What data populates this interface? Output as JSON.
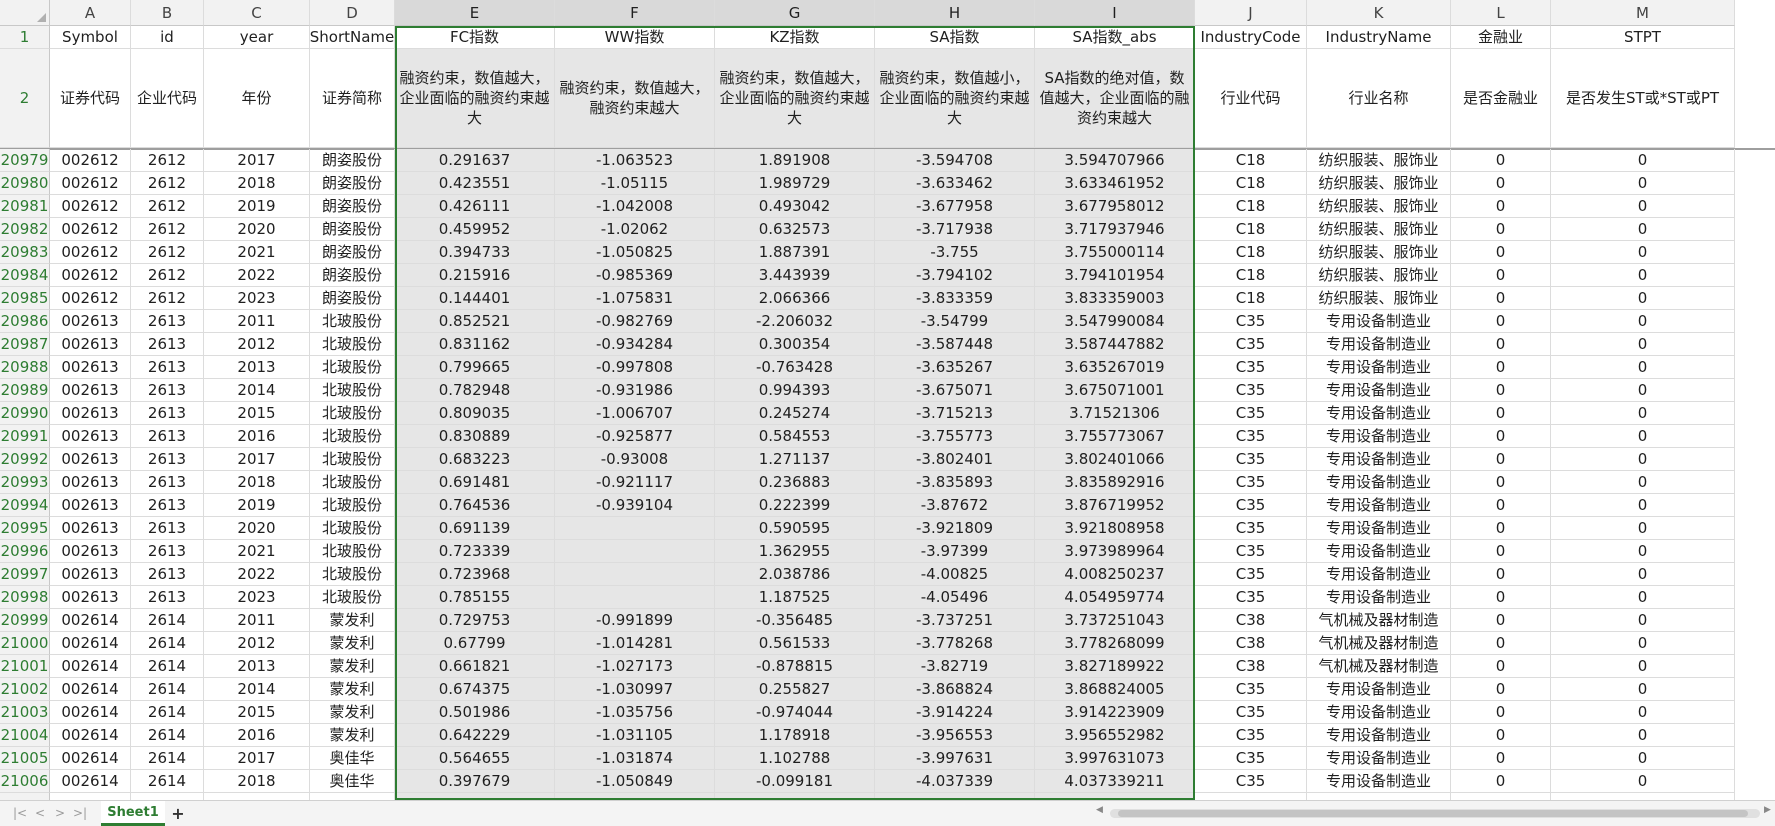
{
  "sheet": {
    "columns": [
      {
        "letter": "A",
        "selected": false
      },
      {
        "letter": "B",
        "selected": false
      },
      {
        "letter": "C",
        "selected": false
      },
      {
        "letter": "D",
        "selected": false
      },
      {
        "letter": "E",
        "selected": true
      },
      {
        "letter": "F",
        "selected": true
      },
      {
        "letter": "G",
        "selected": true
      },
      {
        "letter": "H",
        "selected": true
      },
      {
        "letter": "I",
        "selected": true
      },
      {
        "letter": "J",
        "selected": false
      },
      {
        "letter": "K",
        "selected": false
      },
      {
        "letter": "L",
        "selected": false
      },
      {
        "letter": "M",
        "selected": false
      }
    ],
    "header_row1": {
      "rownum": "1",
      "values": [
        "Symbol",
        "id",
        "year",
        "ShortName",
        "FC指数",
        "WW指数",
        "KZ指数",
        "SA指数",
        "SA指数_abs",
        "IndustryCode",
        "IndustryName",
        "金融业",
        "STPT"
      ]
    },
    "header_row2": {
      "rownum": "2",
      "values": [
        "证券代码",
        "企业代码",
        "年份",
        "证券简称",
        "融资约束，数值越大，企业面临的融资约束越大",
        "融资约束，数值越大，融资约束越大",
        "融资约束，数值越大，企业面临的融资约束越大",
        "融资约束，数值越小，企业面临的融资约束越大",
        "SA指数的绝对值，数值越大，企业面临的融资约束越大",
        "行业代码",
        "行业名称",
        "是否金融业",
        "是否发生ST或*ST或PT"
      ]
    },
    "rows": [
      {
        "rownum": "20979",
        "values": [
          "002612",
          "2612",
          "2017",
          "朗姿股份",
          "0.291637",
          "-1.063523",
          "1.891908",
          "-3.594708",
          "3.594707966",
          "C18",
          "纺织服装、服饰业",
          "0",
          "0"
        ]
      },
      {
        "rownum": "20980",
        "values": [
          "002612",
          "2612",
          "2018",
          "朗姿股份",
          "0.423551",
          "-1.05115",
          "1.989729",
          "-3.633462",
          "3.633461952",
          "C18",
          "纺织服装、服饰业",
          "0",
          "0"
        ]
      },
      {
        "rownum": "20981",
        "values": [
          "002612",
          "2612",
          "2019",
          "朗姿股份",
          "0.426111",
          "-1.042008",
          "0.493042",
          "-3.677958",
          "3.677958012",
          "C18",
          "纺织服装、服饰业",
          "0",
          "0"
        ]
      },
      {
        "rownum": "20982",
        "values": [
          "002612",
          "2612",
          "2020",
          "朗姿股份",
          "0.459952",
          "-1.02062",
          "0.632573",
          "-3.717938",
          "3.717937946",
          "C18",
          "纺织服装、服饰业",
          "0",
          "0"
        ]
      },
      {
        "rownum": "20983",
        "values": [
          "002612",
          "2612",
          "2021",
          "朗姿股份",
          "0.394733",
          "-1.050825",
          "1.887391",
          "-3.755",
          "3.755000114",
          "C18",
          "纺织服装、服饰业",
          "0",
          "0"
        ]
      },
      {
        "rownum": "20984",
        "values": [
          "002612",
          "2612",
          "2022",
          "朗姿股份",
          "0.215916",
          "-0.985369",
          "3.443939",
          "-3.794102",
          "3.794101954",
          "C18",
          "纺织服装、服饰业",
          "0",
          "0"
        ]
      },
      {
        "rownum": "20985",
        "values": [
          "002612",
          "2612",
          "2023",
          "朗姿股份",
          "0.144401",
          "-1.075831",
          "2.066366",
          "-3.833359",
          "3.833359003",
          "C18",
          "纺织服装、服饰业",
          "0",
          "0"
        ]
      },
      {
        "rownum": "20986",
        "values": [
          "002613",
          "2613",
          "2011",
          "北玻股份",
          "0.852521",
          "-0.982769",
          "-2.206032",
          "-3.54799",
          "3.547990084",
          "C35",
          "专用设备制造业",
          "0",
          "0"
        ]
      },
      {
        "rownum": "20987",
        "values": [
          "002613",
          "2613",
          "2012",
          "北玻股份",
          "0.831162",
          "-0.934284",
          "0.300354",
          "-3.587448",
          "3.587447882",
          "C35",
          "专用设备制造业",
          "0",
          "0"
        ]
      },
      {
        "rownum": "20988",
        "values": [
          "002613",
          "2613",
          "2013",
          "北玻股份",
          "0.799665",
          "-0.997808",
          "-0.763428",
          "-3.635267",
          "3.635267019",
          "C35",
          "专用设备制造业",
          "0",
          "0"
        ]
      },
      {
        "rownum": "20989",
        "values": [
          "002613",
          "2613",
          "2014",
          "北玻股份",
          "0.782948",
          "-0.931986",
          "0.994393",
          "-3.675071",
          "3.675071001",
          "C35",
          "专用设备制造业",
          "0",
          "0"
        ]
      },
      {
        "rownum": "20990",
        "values": [
          "002613",
          "2613",
          "2015",
          "北玻股份",
          "0.809035",
          "-1.006707",
          "0.245274",
          "-3.715213",
          "3.71521306",
          "C35",
          "专用设备制造业",
          "0",
          "0"
        ]
      },
      {
        "rownum": "20991",
        "values": [
          "002613",
          "2613",
          "2016",
          "北玻股份",
          "0.830889",
          "-0.925877",
          "0.584553",
          "-3.755773",
          "3.755773067",
          "C35",
          "专用设备制造业",
          "0",
          "0"
        ]
      },
      {
        "rownum": "20992",
        "values": [
          "002613",
          "2613",
          "2017",
          "北玻股份",
          "0.683223",
          "-0.93008",
          "1.271137",
          "-3.802401",
          "3.802401066",
          "C35",
          "专用设备制造业",
          "0",
          "0"
        ]
      },
      {
        "rownum": "20993",
        "values": [
          "002613",
          "2613",
          "2018",
          "北玻股份",
          "0.691481",
          "-0.921117",
          "0.236883",
          "-3.835893",
          "3.835892916",
          "C35",
          "专用设备制造业",
          "0",
          "0"
        ]
      },
      {
        "rownum": "20994",
        "values": [
          "002613",
          "2613",
          "2019",
          "北玻股份",
          "0.764536",
          "-0.939104",
          "0.222399",
          "-3.87672",
          "3.876719952",
          "C35",
          "专用设备制造业",
          "0",
          "0"
        ]
      },
      {
        "rownum": "20995",
        "values": [
          "002613",
          "2613",
          "2020",
          "北玻股份",
          "0.691139",
          "",
          "0.590595",
          "-3.921809",
          "3.921808958",
          "C35",
          "专用设备制造业",
          "0",
          "0"
        ]
      },
      {
        "rownum": "20996",
        "values": [
          "002613",
          "2613",
          "2021",
          "北玻股份",
          "0.723339",
          "",
          "1.362955",
          "-3.97399",
          "3.973989964",
          "C35",
          "专用设备制造业",
          "0",
          "0"
        ]
      },
      {
        "rownum": "20997",
        "values": [
          "002613",
          "2613",
          "2022",
          "北玻股份",
          "0.723968",
          "",
          "2.038786",
          "-4.00825",
          "4.008250237",
          "C35",
          "专用设备制造业",
          "0",
          "0"
        ]
      },
      {
        "rownum": "20998",
        "values": [
          "002613",
          "2613",
          "2023",
          "北玻股份",
          "0.785155",
          "",
          "1.187525",
          "-4.05496",
          "4.054959774",
          "C35",
          "专用设备制造业",
          "0",
          "0"
        ]
      },
      {
        "rownum": "20999",
        "values": [
          "002614",
          "2614",
          "2011",
          "蒙发利",
          "0.729753",
          "-0.991899",
          "-0.356485",
          "-3.737251",
          "3.737251043",
          "C38",
          "气机械及器材制造",
          "0",
          "0"
        ]
      },
      {
        "rownum": "21000",
        "values": [
          "002614",
          "2614",
          "2012",
          "蒙发利",
          "0.67799",
          "-1.014281",
          "0.561533",
          "-3.778268",
          "3.778268099",
          "C38",
          "气机械及器材制造",
          "0",
          "0"
        ]
      },
      {
        "rownum": "21001",
        "values": [
          "002614",
          "2614",
          "2013",
          "蒙发利",
          "0.661821",
          "-1.027173",
          "-0.878815",
          "-3.82719",
          "3.827189922",
          "C38",
          "气机械及器材制造",
          "0",
          "0"
        ]
      },
      {
        "rownum": "21002",
        "values": [
          "002614",
          "2614",
          "2014",
          "蒙发利",
          "0.674375",
          "-1.030997",
          "0.255827",
          "-3.868824",
          "3.868824005",
          "C35",
          "专用设备制造业",
          "0",
          "0"
        ]
      },
      {
        "rownum": "21003",
        "values": [
          "002614",
          "2614",
          "2015",
          "蒙发利",
          "0.501986",
          "-1.035756",
          "-0.974044",
          "-3.914224",
          "3.914223909",
          "C35",
          "专用设备制造业",
          "0",
          "0"
        ]
      },
      {
        "rownum": "21004",
        "values": [
          "002614",
          "2614",
          "2016",
          "蒙发利",
          "0.642229",
          "-1.031105",
          "1.178918",
          "-3.956553",
          "3.956552982",
          "C35",
          "专用设备制造业",
          "0",
          "0"
        ]
      },
      {
        "rownum": "21005",
        "values": [
          "002614",
          "2614",
          "2017",
          "奥佳华",
          "0.564655",
          "-1.031874",
          "1.102788",
          "-3.997631",
          "3.997631073",
          "C35",
          "专用设备制造业",
          "0",
          "0"
        ]
      },
      {
        "rownum": "21006",
        "values": [
          "002614",
          "2614",
          "2018",
          "奥佳华",
          "0.397679",
          "-1.050849",
          "-0.099181",
          "-4.037339",
          "4.037339211",
          "C35",
          "专用设备制造业",
          "0",
          "0"
        ]
      }
    ]
  },
  "tabbar": {
    "first_icon": "first-sheet-icon",
    "prev_icon": "prev-sheet-icon",
    "next_icon": "next-sheet-icon",
    "last_icon": "last-sheet-icon",
    "sheet_tab_label": "Sheet1",
    "add_sheet_label": "+"
  },
  "colors": {
    "accent": "#2e7d32",
    "selection_fill": "#e6e6e6",
    "header_fill": "#f2f2f2"
  }
}
